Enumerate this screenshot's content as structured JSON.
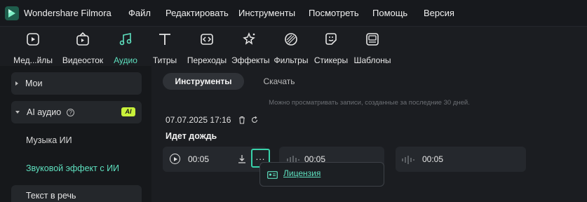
{
  "app": {
    "name": "Wondershare Filmora",
    "accent": "#5ee0bf"
  },
  "menu": [
    "Файл",
    "Редактировать",
    "Инструменты",
    "Посмотреть",
    "Помощь",
    "Версия"
  ],
  "toolbar": {
    "items": [
      {
        "label": "Мед...йлы",
        "icon": "media-icon"
      },
      {
        "label": "Видеосток",
        "icon": "stock-video-icon"
      },
      {
        "label": "Аудио",
        "icon": "music-note-icon",
        "active": true
      },
      {
        "label": "Титры",
        "icon": "text-icon"
      },
      {
        "label": "Переходы",
        "icon": "transition-icon"
      },
      {
        "label": "Эффекты",
        "icon": "effects-icon"
      },
      {
        "label": "Фильтры",
        "icon": "filter-icon"
      },
      {
        "label": "Стикеры",
        "icon": "sticker-icon"
      },
      {
        "label": "Шаблоны",
        "icon": "template-icon"
      }
    ]
  },
  "sidebar": {
    "mine": "Мои",
    "ai_audio": "AI аудио",
    "ai_badge": "AI",
    "ai_music": "Музыка ИИ",
    "ai_sfx": "Звуковой эффект с ИИ",
    "tts": "Текст в речь"
  },
  "main": {
    "tabs": [
      "Инструменты",
      "Скачать"
    ],
    "notice": "Можно просматривать записи, созданные за последние 30 дней.",
    "date": "07.07.2025 17:16",
    "title": "Идет дождь",
    "cards": [
      {
        "time": "00:05"
      },
      {
        "time": "00:05"
      },
      {
        "time": "00:05"
      }
    ],
    "more_label": "...",
    "menu_link": "Лицензия"
  }
}
